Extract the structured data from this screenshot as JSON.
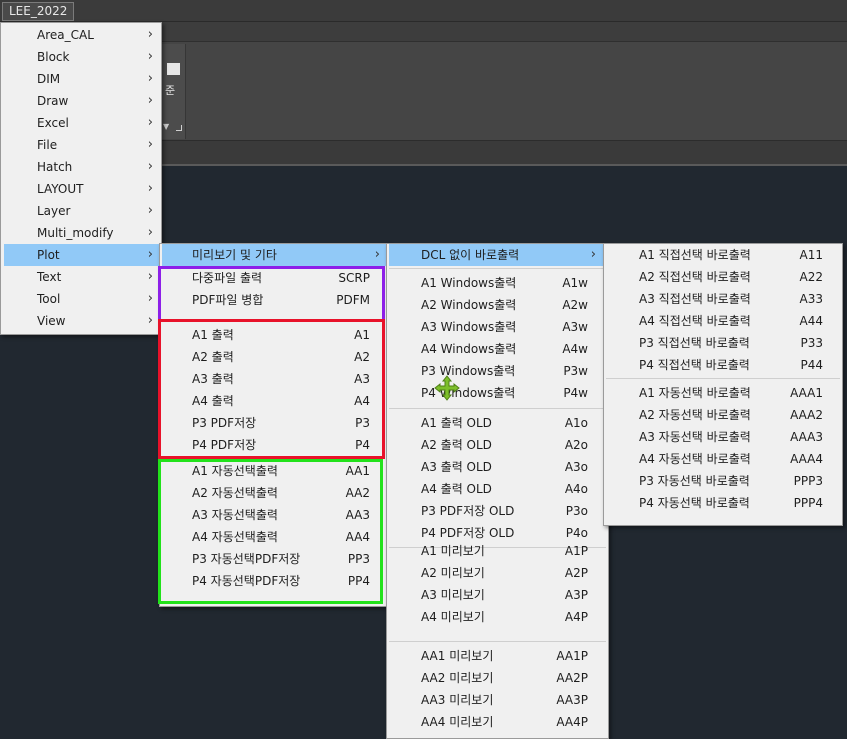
{
  "app": {
    "tab_label": "LEE_2022"
  },
  "ribbon": {
    "panel_glyph": "준"
  },
  "menus": {
    "root": {
      "items": [
        {
          "label": "Area_CAL"
        },
        {
          "label": "Block"
        },
        {
          "label": "DIM"
        },
        {
          "label": "Draw"
        },
        {
          "label": "Excel"
        },
        {
          "label": "File"
        },
        {
          "label": "Hatch"
        },
        {
          "label": "LAYOUT"
        },
        {
          "label": "Layer"
        },
        {
          "label": "Multi_modify"
        },
        {
          "label": "Plot"
        },
        {
          "label": "Text"
        },
        {
          "label": "Tool"
        },
        {
          "label": "View"
        }
      ],
      "active": "Plot"
    },
    "plot": {
      "header": {
        "label": "미리보기 및 기타"
      },
      "groups": [
        [
          {
            "label": "다중파일 출력",
            "shortcut": "SCRP"
          },
          {
            "label": "PDF파일 병합",
            "shortcut": "PDFM"
          }
        ],
        [
          {
            "label": "A1 출력",
            "shortcut": "A1"
          },
          {
            "label": "A2 출력",
            "shortcut": "A2"
          },
          {
            "label": "A3 출력",
            "shortcut": "A3"
          },
          {
            "label": "A4 출력",
            "shortcut": "A4"
          },
          {
            "label": "P3 PDF저장",
            "shortcut": "P3"
          },
          {
            "label": "P4 PDF저장",
            "shortcut": "P4"
          }
        ],
        [
          {
            "label": "A1 자동선택출력",
            "shortcut": "AA1"
          },
          {
            "label": "A2 자동선택출력",
            "shortcut": "AA2"
          },
          {
            "label": "A3 자동선택출력",
            "shortcut": "AA3"
          },
          {
            "label": "A4 자동선택출력",
            "shortcut": "AA4"
          },
          {
            "label": "P3 자동선택PDF저장",
            "shortcut": "PP3"
          },
          {
            "label": "P4 자동선택PDF저장",
            "shortcut": "PP4"
          }
        ]
      ]
    },
    "preview": {
      "header": {
        "label": "DCL 없이 바로출력"
      },
      "groups": [
        [
          {
            "label": "A1 Windows출력",
            "shortcut": "A1w"
          },
          {
            "label": "A2 Windows출력",
            "shortcut": "A2w"
          },
          {
            "label": "A3 Windows출력",
            "shortcut": "A3w"
          },
          {
            "label": "A4 Windows출력",
            "shortcut": "A4w"
          },
          {
            "label": "P3 Windows출력",
            "shortcut": "P3w"
          },
          {
            "label": "P4 Windows출력",
            "shortcut": "P4w"
          }
        ],
        [
          {
            "label": "A1 출력 OLD",
            "shortcut": "A1o"
          },
          {
            "label": "A2 출력 OLD",
            "shortcut": "A2o"
          },
          {
            "label": "A3 출력 OLD",
            "shortcut": "A3o"
          },
          {
            "label": "A4 출력 OLD",
            "shortcut": "A4o"
          },
          {
            "label": "P3 PDF저장 OLD",
            "shortcut": "P3o"
          },
          {
            "label": "P4 PDF저장 OLD",
            "shortcut": "P4o"
          }
        ],
        [
          {
            "label": "A1 미리보기",
            "shortcut": "A1P"
          },
          {
            "label": "A2 미리보기",
            "shortcut": "A2P"
          },
          {
            "label": "A3 미리보기",
            "shortcut": "A3P"
          },
          {
            "label": "A4 미리보기",
            "shortcut": "A4P"
          }
        ],
        [
          {
            "label": "AA1 미리보기",
            "shortcut": "AA1P"
          },
          {
            "label": "AA2 미리보기",
            "shortcut": "AA2P"
          },
          {
            "label": "AA3 미리보기",
            "shortcut": "AA3P"
          },
          {
            "label": "AA4 미리보기",
            "shortcut": "AA4P"
          }
        ]
      ]
    },
    "direct": {
      "groups": [
        [
          {
            "label": "A1 직접선택 바로출력",
            "shortcut": "A11"
          },
          {
            "label": "A2 직접선택 바로출력",
            "shortcut": "A22"
          },
          {
            "label": "A3 직접선택 바로출력",
            "shortcut": "A33"
          },
          {
            "label": "A4 직접선택 바로출력",
            "shortcut": "A44"
          },
          {
            "label": "P3 직접선택 바로출력",
            "shortcut": "P33"
          },
          {
            "label": "P4 직접선택 바로출력",
            "shortcut": "P44"
          }
        ],
        [
          {
            "label": "A1 자동선택 바로출력",
            "shortcut": "AAA1"
          },
          {
            "label": "A2 자동선택 바로출력",
            "shortcut": "AAA2"
          },
          {
            "label": "A3 자동선택 바로출력",
            "shortcut": "AAA3"
          },
          {
            "label": "A4 자동선택 바로출력",
            "shortcut": "AAA4"
          },
          {
            "label": "P3 자동선택 바로출력",
            "shortcut": "PPP3"
          },
          {
            "label": "P4 자동선택 바로출력",
            "shortcut": "PPP4"
          }
        ]
      ]
    }
  },
  "colors": {
    "menu_bg": "#f0f0f0",
    "menu_highlight": "#91c9f7",
    "box_purple": "#8d1fe8",
    "box_red": "#e8122a",
    "box_green": "#22e21b",
    "cursor": "#7dbf2a",
    "workspace": "#212830"
  },
  "icons": {
    "submenu": "chevron-right-icon",
    "cursor": "move-cursor-icon"
  }
}
